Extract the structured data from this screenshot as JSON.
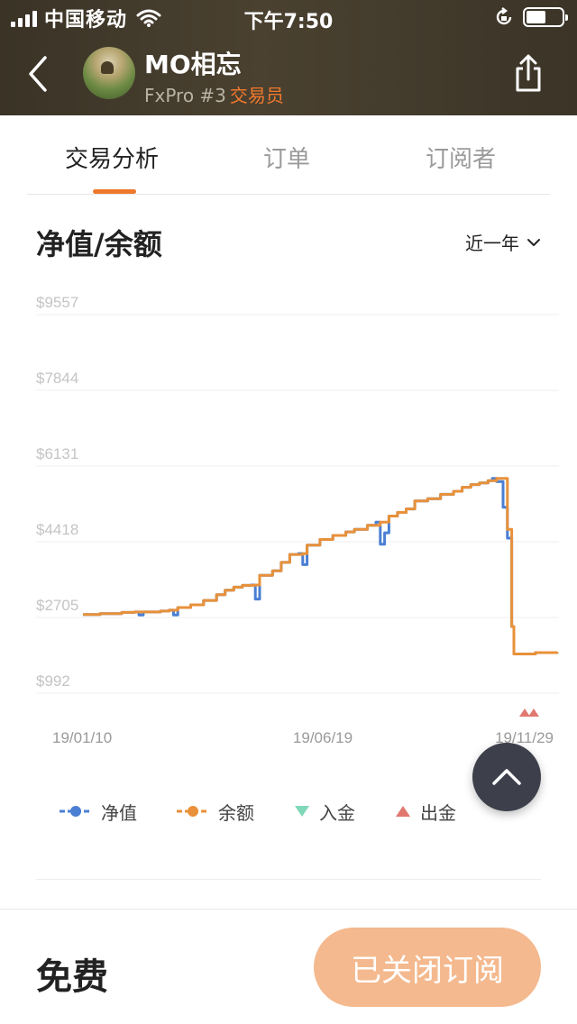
{
  "status_bar": {
    "carrier": "中国移动",
    "time": "下午7:50"
  },
  "trader": {
    "name": "MO相忘",
    "broker": "FxPro #3",
    "role": "交易员"
  },
  "tabs": [
    {
      "label": "交易分析",
      "active": true
    },
    {
      "label": "订单",
      "active": false
    },
    {
      "label": "订阅者",
      "active": false
    }
  ],
  "section": {
    "title": "净值/余额",
    "range": "近一年"
  },
  "chart_data": {
    "type": "line",
    "title": "",
    "y_ticks": [
      "$9557",
      "$7844",
      "$6131",
      "$4418",
      "$2705",
      "$992"
    ],
    "ylim": [
      992,
      9557
    ],
    "x_ticks": [
      "19/01/10",
      "19/06/19",
      "19/11/29"
    ],
    "grid": true,
    "legend_position": "bottom",
    "colors": {
      "equity": "#4a7fd4",
      "balance": "#e8913a",
      "deposit": "#7fd8b8",
      "withdraw": "#e07870"
    },
    "series": [
      {
        "name": "净值",
        "points": [
          [
            0.0,
            2770
          ],
          [
            0.04,
            2790
          ],
          [
            0.09,
            2820
          ],
          [
            0.12,
            2830
          ],
          [
            0.13,
            2760
          ],
          [
            0.14,
            2830
          ],
          [
            0.18,
            2850
          ],
          [
            0.2,
            2870
          ],
          [
            0.21,
            2760
          ],
          [
            0.22,
            2930
          ],
          [
            0.25,
            2990
          ],
          [
            0.28,
            3090
          ],
          [
            0.31,
            3220
          ],
          [
            0.33,
            3320
          ],
          [
            0.35,
            3390
          ],
          [
            0.37,
            3430
          ],
          [
            0.39,
            3440
          ],
          [
            0.4,
            3120
          ],
          [
            0.41,
            3660
          ],
          [
            0.44,
            3760
          ],
          [
            0.46,
            3950
          ],
          [
            0.48,
            4130
          ],
          [
            0.5,
            4150
          ],
          [
            0.51,
            3900
          ],
          [
            0.52,
            4340
          ],
          [
            0.55,
            4470
          ],
          [
            0.58,
            4560
          ],
          [
            0.61,
            4640
          ],
          [
            0.63,
            4700
          ],
          [
            0.66,
            4790
          ],
          [
            0.68,
            4860
          ],
          [
            0.69,
            4360
          ],
          [
            0.7,
            4620
          ],
          [
            0.71,
            5000
          ],
          [
            0.73,
            5080
          ],
          [
            0.75,
            5160
          ],
          [
            0.77,
            5340
          ],
          [
            0.8,
            5390
          ],
          [
            0.83,
            5490
          ],
          [
            0.86,
            5560
          ],
          [
            0.88,
            5650
          ],
          [
            0.9,
            5710
          ],
          [
            0.92,
            5750
          ],
          [
            0.94,
            5800
          ],
          [
            0.95,
            5850
          ],
          [
            0.96,
            5780
          ],
          [
            0.975,
            5200
          ],
          [
            0.985,
            4500
          ],
          [
            0.995,
            2500
          ],
          [
            1.0,
            1880
          ],
          [
            1.05,
            1910
          ],
          [
            1.1,
            1930
          ]
        ]
      },
      {
        "name": "余额",
        "points": [
          [
            0.0,
            2770
          ],
          [
            0.04,
            2790
          ],
          [
            0.09,
            2820
          ],
          [
            0.12,
            2830
          ],
          [
            0.14,
            2830
          ],
          [
            0.18,
            2850
          ],
          [
            0.2,
            2870
          ],
          [
            0.22,
            2930
          ],
          [
            0.25,
            2990
          ],
          [
            0.28,
            3090
          ],
          [
            0.31,
            3220
          ],
          [
            0.33,
            3320
          ],
          [
            0.35,
            3390
          ],
          [
            0.37,
            3430
          ],
          [
            0.4,
            3440
          ],
          [
            0.41,
            3660
          ],
          [
            0.44,
            3760
          ],
          [
            0.46,
            3950
          ],
          [
            0.48,
            4130
          ],
          [
            0.51,
            4150
          ],
          [
            0.52,
            4340
          ],
          [
            0.55,
            4470
          ],
          [
            0.58,
            4560
          ],
          [
            0.61,
            4640
          ],
          [
            0.63,
            4700
          ],
          [
            0.66,
            4790
          ],
          [
            0.69,
            4860
          ],
          [
            0.71,
            5000
          ],
          [
            0.73,
            5080
          ],
          [
            0.75,
            5160
          ],
          [
            0.77,
            5340
          ],
          [
            0.8,
            5390
          ],
          [
            0.83,
            5490
          ],
          [
            0.86,
            5560
          ],
          [
            0.88,
            5650
          ],
          [
            0.9,
            5710
          ],
          [
            0.92,
            5750
          ],
          [
            0.94,
            5800
          ],
          [
            0.96,
            5850
          ],
          [
            0.97,
            5850
          ],
          [
            0.985,
            4700
          ],
          [
            0.995,
            2500
          ],
          [
            1.0,
            1880
          ],
          [
            1.05,
            1910
          ],
          [
            1.1,
            1930
          ]
        ]
      }
    ],
    "withdraw_markers": 2
  },
  "legend": [
    {
      "label": "净值",
      "kind": "line-dot",
      "color": "#4a7fd4"
    },
    {
      "label": "余额",
      "kind": "line-dot",
      "color": "#e8913a"
    },
    {
      "label": "入金",
      "kind": "triangle-down",
      "color": "#7fd8b8"
    },
    {
      "label": "出金",
      "kind": "triangle-up",
      "color": "#e07870"
    }
  ],
  "footer": {
    "price": "免费",
    "subscribe_label": "已关闭订阅"
  }
}
